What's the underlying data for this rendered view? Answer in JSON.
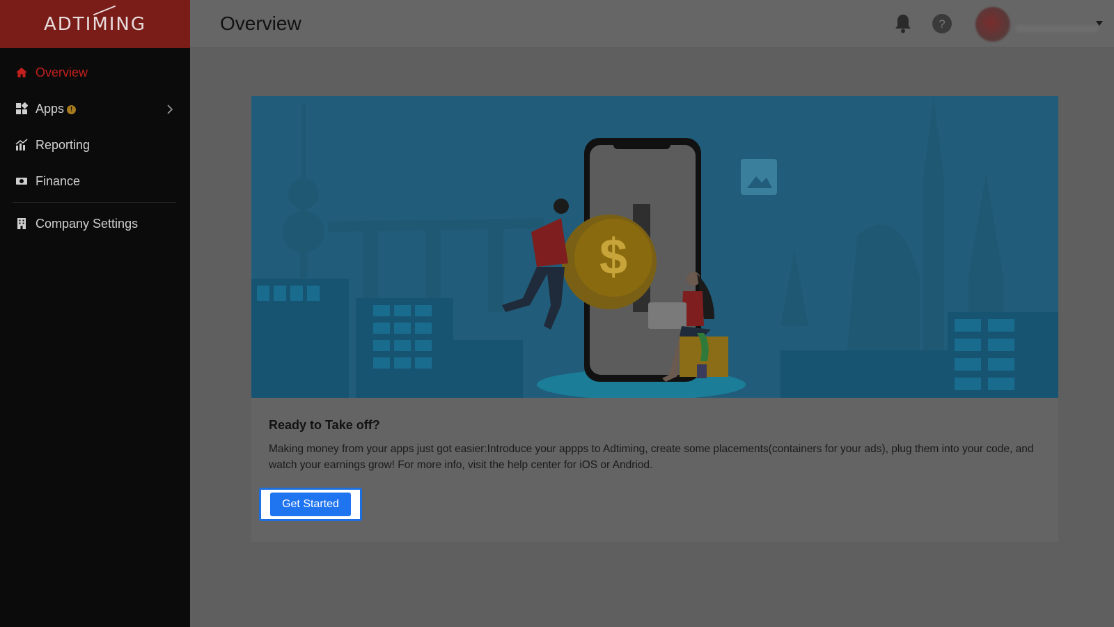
{
  "brand": {
    "logo_text": "ADTIMING",
    "accent": "#c3201d"
  },
  "sidebar": {
    "items": [
      {
        "label": "Overview",
        "icon": "home-icon",
        "active": true
      },
      {
        "label": "Apps",
        "icon": "grid-icon",
        "badge": "!"
      },
      {
        "label": "Reporting",
        "icon": "chart-icon"
      },
      {
        "label": "Finance",
        "icon": "money-icon"
      },
      {
        "label": "Company Settings",
        "icon": "building-icon"
      }
    ]
  },
  "header": {
    "title": "Overview"
  },
  "card": {
    "title": "Ready to Take off?",
    "description": "Making money from your apps just got easier:Introduce your appps to Adtiming, create some placements(containers for your ads), plug them into your code, and watch your earnings grow! For more info, visit the help center for iOS or Andriod.",
    "button_label": "Get Started"
  },
  "colors": {
    "button": "#1f74f0",
    "banner": "#215d7a",
    "sidebar": "#0b0b0b",
    "logo_bar": "#7a1d18"
  }
}
